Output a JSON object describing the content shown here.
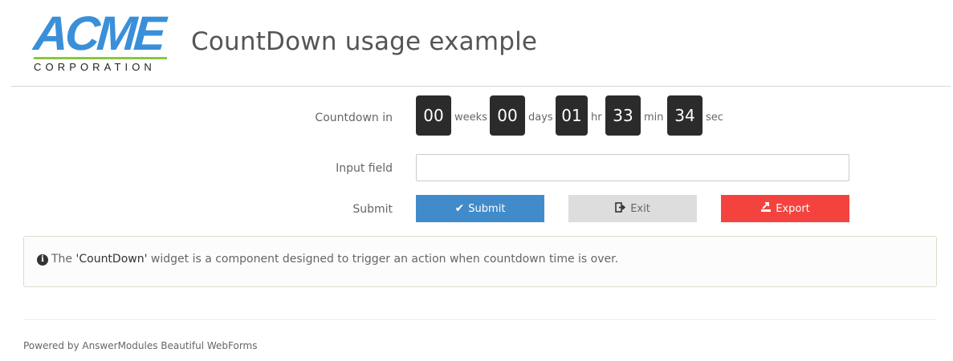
{
  "header": {
    "logo": {
      "wordmark": "ACME",
      "subtitle": "CORPORATION",
      "colors": {
        "wordmark": "#3a8fd9",
        "bar": "#8dc63f"
      }
    },
    "title": "CountDown usage example"
  },
  "form": {
    "countdown": {
      "label": "Countdown in",
      "weeks": {
        "value": "00",
        "unit": "weeks"
      },
      "days": {
        "value": "00",
        "unit": "days"
      },
      "hours": {
        "value": "01",
        "unit": "hr"
      },
      "minutes": {
        "value": "33",
        "unit": "min"
      },
      "seconds": {
        "value": "34",
        "unit": "sec"
      }
    },
    "input": {
      "label": "Input field",
      "value": "",
      "placeholder": ""
    },
    "buttons": {
      "label": "Submit",
      "submit": {
        "label": "Submit",
        "icon": "check-icon",
        "color": "#428bca"
      },
      "exit": {
        "label": "Exit",
        "icon": "sign-out-icon",
        "color": "#dddddd"
      },
      "export": {
        "label": "Export",
        "icon": "export-icon",
        "color": "#f4433f"
      }
    }
  },
  "info": {
    "icon": "info-circle-icon",
    "prefix": "The ",
    "widget_name": "'CountDown'",
    "suffix": " widget is a component designed to trigger an action when countdown time is over."
  },
  "footer": {
    "text": "Powered by AnswerModules Beautiful WebForms"
  }
}
